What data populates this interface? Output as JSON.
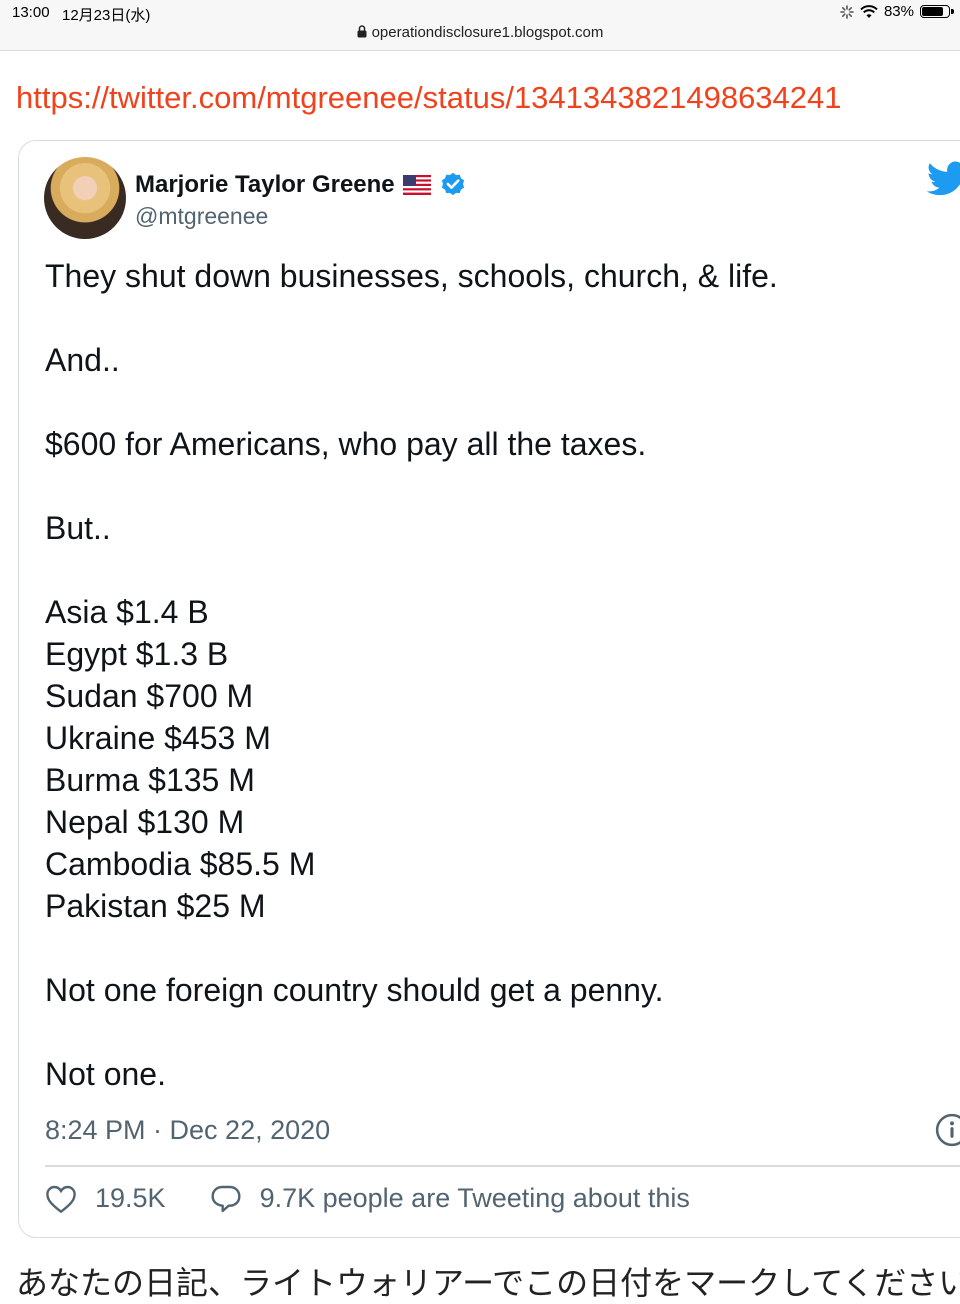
{
  "status_bar": {
    "time": "13:00",
    "date": "12月23日(水)",
    "battery": "83%",
    "battery_level": 0.83
  },
  "browser": {
    "url": "operationdisclosure1.blogspot.com"
  },
  "article": {
    "link_text": "https://twitter.com/mtgreenee/status/1341343821498634241",
    "link_color": "#f0421c"
  },
  "tweet": {
    "author_name": "Marjorie Taylor Greene",
    "handle": "@mtgreenee",
    "flag_icon": "us-flag-icon",
    "verified_icon": "verified-badge-icon",
    "paragraphs": [
      "They shut down businesses, schools, church, & life.",
      "And..",
      "$600 for Americans, who pay all the taxes.",
      "But.."
    ],
    "aid_list": [
      "Asia $1.4 B",
      "Egypt $1.3 B",
      "Sudan $700 M",
      "Ukraine $453 M",
      "Burma $135 M",
      "Nepal $130 M",
      "Cambodia $85.5 M",
      "Pakistan $25 M"
    ],
    "closing": [
      "Not one foreign country should get a penny.",
      "Not one."
    ],
    "timestamp": "8:24 PM · Dec 22, 2020",
    "likes": "19.5K",
    "tweeting_about": "9.7K people are Tweeting about this",
    "twitter_blue": "#1d9bf0"
  },
  "footer": {
    "text": "あなたの日記、ライトウォリアーでこの日付をマークしてください"
  }
}
